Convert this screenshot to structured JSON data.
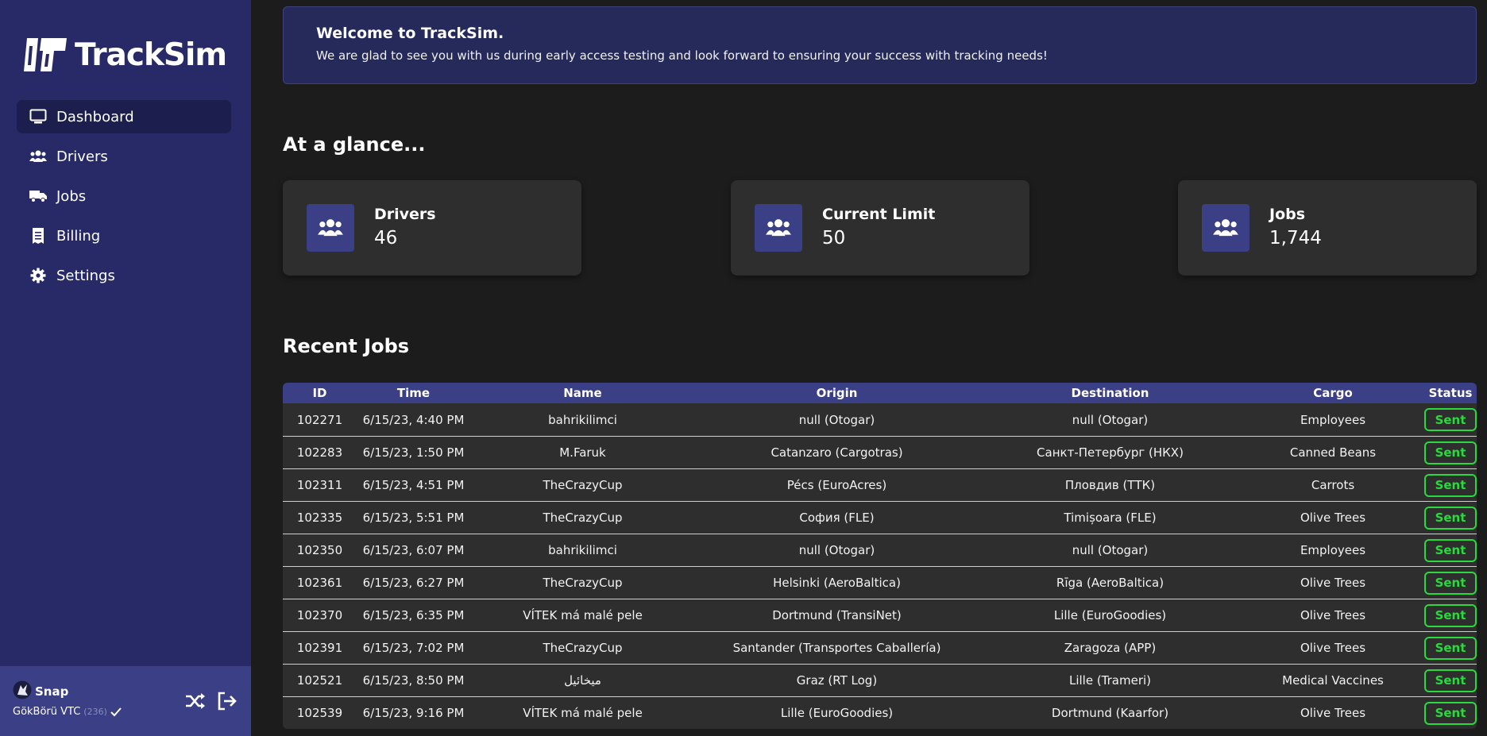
{
  "app": {
    "name": "TrackSim"
  },
  "colors": {
    "sidebar": "#272a67",
    "accent": "#3b3f85",
    "status_sent": "#29d93e",
    "background": "#1c1c1c"
  },
  "sidebar": {
    "items": [
      {
        "label": "Dashboard",
        "icon": "monitor-icon",
        "active": true
      },
      {
        "label": "Drivers",
        "icon": "users-icon",
        "active": false
      },
      {
        "label": "Jobs",
        "icon": "truck-icon",
        "active": false
      },
      {
        "label": "Billing",
        "icon": "receipt-icon",
        "active": false
      },
      {
        "label": "Settings",
        "icon": "gear-icon",
        "active": false
      }
    ]
  },
  "user": {
    "name": "Snap",
    "vtc": "GökBörü VTC",
    "vtc_id": "(236)"
  },
  "welcome": {
    "title": "Welcome to TrackSim.",
    "text": "We are glad to see you with us during early access testing and look forward to ensuring your success with tracking needs!"
  },
  "glance": {
    "title": "At a glance...",
    "cards": [
      {
        "label": "Drivers",
        "value": "46",
        "icon": "users-icon"
      },
      {
        "label": "Current Limit",
        "value": "50",
        "icon": "users-icon"
      },
      {
        "label": "Jobs",
        "value": "1,744",
        "icon": "users-icon"
      }
    ]
  },
  "recent_jobs": {
    "title": "Recent Jobs",
    "columns": [
      "ID",
      "Time",
      "Name",
      "Origin",
      "Destination",
      "Cargo",
      "Status"
    ],
    "rows": [
      {
        "id": "102271",
        "time": "6/15/23, 4:40 PM",
        "name": "bahrikilimci",
        "origin": "null (Otogar)",
        "destination": "null (Otogar)",
        "cargo": "Employees",
        "status": "Sent"
      },
      {
        "id": "102283",
        "time": "6/15/23, 1:50 PM",
        "name": "M.Faruk",
        "origin": "Catanzaro (Cargotras)",
        "destination": "Санкт-Петербург (НКХ)",
        "cargo": "Canned Beans",
        "status": "Sent"
      },
      {
        "id": "102311",
        "time": "6/15/23, 4:51 PM",
        "name": "TheCrazyCup",
        "origin": "Pécs (EuroAcres)",
        "destination": "Пловдив (ТТК)",
        "cargo": "Carrots",
        "status": "Sent"
      },
      {
        "id": "102335",
        "time": "6/15/23, 5:51 PM",
        "name": "TheCrazyCup",
        "origin": "София (FLE)",
        "destination": "Timișoara (FLE)",
        "cargo": "Olive Trees",
        "status": "Sent"
      },
      {
        "id": "102350",
        "time": "6/15/23, 6:07 PM",
        "name": "bahrikilimci",
        "origin": "null (Otogar)",
        "destination": "null (Otogar)",
        "cargo": "Employees",
        "status": "Sent"
      },
      {
        "id": "102361",
        "time": "6/15/23, 6:27 PM",
        "name": "TheCrazyCup",
        "origin": "Helsinki (AeroBaltica)",
        "destination": "Rīga (AeroBaltica)",
        "cargo": "Olive Trees",
        "status": "Sent"
      },
      {
        "id": "102370",
        "time": "6/15/23, 6:35 PM",
        "name": "VÍTEK má malé pele",
        "origin": "Dortmund (TransiNet)",
        "destination": "Lille (EuroGoodies)",
        "cargo": "Olive Trees",
        "status": "Sent"
      },
      {
        "id": "102391",
        "time": "6/15/23, 7:02 PM",
        "name": "TheCrazyCup",
        "origin": "Santander (Transportes Caballería)",
        "destination": "Zaragoza (APP)",
        "cargo": "Olive Trees",
        "status": "Sent"
      },
      {
        "id": "102521",
        "time": "6/15/23, 8:50 PM",
        "name": "ميخائيل",
        "origin": "Graz (RT Log)",
        "destination": "Lille (Trameri)",
        "cargo": "Medical Vaccines",
        "status": "Sent"
      },
      {
        "id": "102539",
        "time": "6/15/23, 9:16 PM",
        "name": "VÍTEK má malé pele",
        "origin": "Lille (EuroGoodies)",
        "destination": "Dortmund (Kaarfor)",
        "cargo": "Olive Trees",
        "status": "Sent"
      }
    ]
  }
}
